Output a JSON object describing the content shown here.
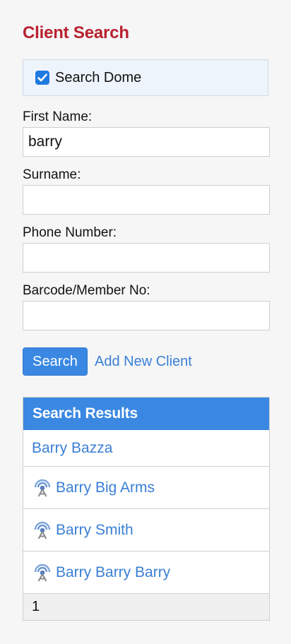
{
  "page": {
    "title": "Client Search"
  },
  "dome_filter": {
    "label": "Search Dome",
    "checked": true,
    "accent_color": "#1f7ae0"
  },
  "fields": {
    "first_name": {
      "label": "First Name:",
      "value": "barry"
    },
    "surname": {
      "label": "Surname:",
      "value": ""
    },
    "phone": {
      "label": "Phone Number:",
      "value": ""
    },
    "barcode": {
      "label": "Barcode/Member No:",
      "value": ""
    }
  },
  "actions": {
    "search_label": "Search",
    "add_client_label": "Add New Client"
  },
  "results": {
    "header": "Search Results",
    "items": [
      {
        "name": "Barry Bazza",
        "icon": ""
      },
      {
        "name": "Barry Big Arms",
        "icon": "dome-signal-icon"
      },
      {
        "name": "Barry Smith",
        "icon": "dome-signal-icon"
      },
      {
        "name": "Barry Barry Barry",
        "icon": "dome-signal-icon"
      }
    ],
    "page": "1"
  },
  "colors": {
    "title": "#b8212f",
    "primary": "#3a88e2",
    "link": "#3a7fd5",
    "background": "#f6f6f6"
  }
}
